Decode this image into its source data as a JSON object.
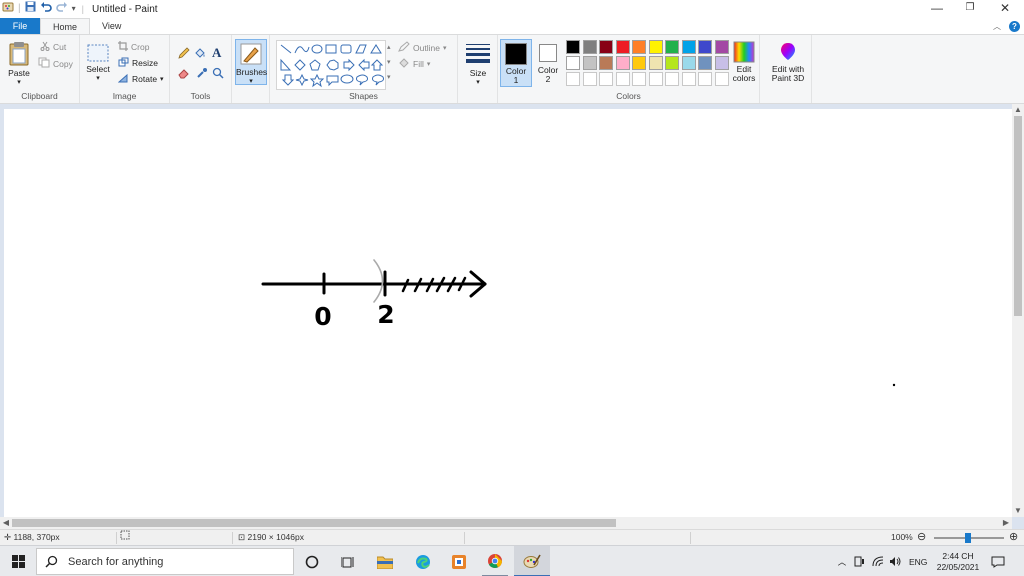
{
  "window": {
    "title": "Untitled - Paint",
    "controls": {
      "minimize": "—",
      "restore": "❐",
      "close": "✕"
    }
  },
  "tabs": [
    {
      "label": "File"
    },
    {
      "label": "Home"
    },
    {
      "label": "View"
    }
  ],
  "ribbon": {
    "clipboard": {
      "paste": "Paste",
      "cut": "Cut",
      "copy": "Copy",
      "label": "Clipboard"
    },
    "image": {
      "select": "Select",
      "crop": "Crop",
      "resize": "Resize",
      "rotate": "Rotate",
      "label": "Image"
    },
    "tools": {
      "label": "Tools"
    },
    "brushes": {
      "label": "Brushes"
    },
    "shapes": {
      "outline": "Outline",
      "fill": "Fill",
      "label": "Shapes"
    },
    "size": {
      "label": "Size"
    },
    "color1": {
      "label": "Color",
      "num": "1",
      "color": "#000000"
    },
    "color2": {
      "label": "Color",
      "num": "2",
      "color": "#ffffff"
    },
    "colors": {
      "label": "Colors",
      "row1": [
        "#000000",
        "#7f7f7f",
        "#880015",
        "#ed1c24",
        "#ff7f27",
        "#fff200",
        "#22b14c",
        "#00a2e8",
        "#3f48cc",
        "#a349a4"
      ],
      "row2": [
        "#ffffff",
        "#c3c3c3",
        "#b97a57",
        "#ffaec9",
        "#ffc90e",
        "#efe4b0",
        "#b5e61d",
        "#99d9ea",
        "#7092be",
        "#c8bfe7"
      ]
    },
    "edit_colors": {
      "line1": "Edit",
      "line2": "colors"
    },
    "paint3d": {
      "line1": "Edit with",
      "line2": "Paint 3D"
    }
  },
  "drawing": {
    "labels": [
      "0",
      "2"
    ]
  },
  "status": {
    "cursor_pos": "1188, 370px",
    "image_size": "2190 × 1046px",
    "zoom": "100%"
  },
  "taskbar": {
    "search_placeholder": "Search for anything",
    "lang": "ENG",
    "time": "2:44 CH",
    "date": "22/05/2021"
  }
}
